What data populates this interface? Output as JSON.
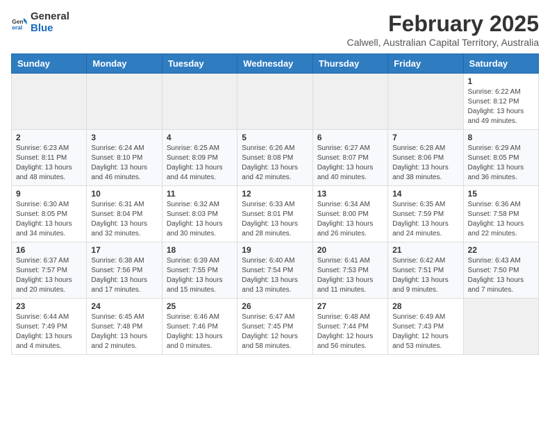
{
  "logo": {
    "line1": "General",
    "line2": "Blue"
  },
  "title": {
    "month_year": "February 2025",
    "location": "Calwell, Australian Capital Territory, Australia"
  },
  "weekdays": [
    "Sunday",
    "Monday",
    "Tuesday",
    "Wednesday",
    "Thursday",
    "Friday",
    "Saturday"
  ],
  "weeks": [
    [
      {
        "day": "",
        "info": ""
      },
      {
        "day": "",
        "info": ""
      },
      {
        "day": "",
        "info": ""
      },
      {
        "day": "",
        "info": ""
      },
      {
        "day": "",
        "info": ""
      },
      {
        "day": "",
        "info": ""
      },
      {
        "day": "1",
        "info": "Sunrise: 6:22 AM\nSunset: 8:12 PM\nDaylight: 13 hours\nand 49 minutes."
      }
    ],
    [
      {
        "day": "2",
        "info": "Sunrise: 6:23 AM\nSunset: 8:11 PM\nDaylight: 13 hours\nand 48 minutes."
      },
      {
        "day": "3",
        "info": "Sunrise: 6:24 AM\nSunset: 8:10 PM\nDaylight: 13 hours\nand 46 minutes."
      },
      {
        "day": "4",
        "info": "Sunrise: 6:25 AM\nSunset: 8:09 PM\nDaylight: 13 hours\nand 44 minutes."
      },
      {
        "day": "5",
        "info": "Sunrise: 6:26 AM\nSunset: 8:08 PM\nDaylight: 13 hours\nand 42 minutes."
      },
      {
        "day": "6",
        "info": "Sunrise: 6:27 AM\nSunset: 8:07 PM\nDaylight: 13 hours\nand 40 minutes."
      },
      {
        "day": "7",
        "info": "Sunrise: 6:28 AM\nSunset: 8:06 PM\nDaylight: 13 hours\nand 38 minutes."
      },
      {
        "day": "8",
        "info": "Sunrise: 6:29 AM\nSunset: 8:05 PM\nDaylight: 13 hours\nand 36 minutes."
      }
    ],
    [
      {
        "day": "9",
        "info": "Sunrise: 6:30 AM\nSunset: 8:05 PM\nDaylight: 13 hours\nand 34 minutes."
      },
      {
        "day": "10",
        "info": "Sunrise: 6:31 AM\nSunset: 8:04 PM\nDaylight: 13 hours\nand 32 minutes."
      },
      {
        "day": "11",
        "info": "Sunrise: 6:32 AM\nSunset: 8:03 PM\nDaylight: 13 hours\nand 30 minutes."
      },
      {
        "day": "12",
        "info": "Sunrise: 6:33 AM\nSunset: 8:01 PM\nDaylight: 13 hours\nand 28 minutes."
      },
      {
        "day": "13",
        "info": "Sunrise: 6:34 AM\nSunset: 8:00 PM\nDaylight: 13 hours\nand 26 minutes."
      },
      {
        "day": "14",
        "info": "Sunrise: 6:35 AM\nSunset: 7:59 PM\nDaylight: 13 hours\nand 24 minutes."
      },
      {
        "day": "15",
        "info": "Sunrise: 6:36 AM\nSunset: 7:58 PM\nDaylight: 13 hours\nand 22 minutes."
      }
    ],
    [
      {
        "day": "16",
        "info": "Sunrise: 6:37 AM\nSunset: 7:57 PM\nDaylight: 13 hours\nand 20 minutes."
      },
      {
        "day": "17",
        "info": "Sunrise: 6:38 AM\nSunset: 7:56 PM\nDaylight: 13 hours\nand 17 minutes."
      },
      {
        "day": "18",
        "info": "Sunrise: 6:39 AM\nSunset: 7:55 PM\nDaylight: 13 hours\nand 15 minutes."
      },
      {
        "day": "19",
        "info": "Sunrise: 6:40 AM\nSunset: 7:54 PM\nDaylight: 13 hours\nand 13 minutes."
      },
      {
        "day": "20",
        "info": "Sunrise: 6:41 AM\nSunset: 7:53 PM\nDaylight: 13 hours\nand 11 minutes."
      },
      {
        "day": "21",
        "info": "Sunrise: 6:42 AM\nSunset: 7:51 PM\nDaylight: 13 hours\nand 9 minutes."
      },
      {
        "day": "22",
        "info": "Sunrise: 6:43 AM\nSunset: 7:50 PM\nDaylight: 13 hours\nand 7 minutes."
      }
    ],
    [
      {
        "day": "23",
        "info": "Sunrise: 6:44 AM\nSunset: 7:49 PM\nDaylight: 13 hours\nand 4 minutes."
      },
      {
        "day": "24",
        "info": "Sunrise: 6:45 AM\nSunset: 7:48 PM\nDaylight: 13 hours\nand 2 minutes."
      },
      {
        "day": "25",
        "info": "Sunrise: 6:46 AM\nSunset: 7:46 PM\nDaylight: 13 hours\nand 0 minutes."
      },
      {
        "day": "26",
        "info": "Sunrise: 6:47 AM\nSunset: 7:45 PM\nDaylight: 12 hours\nand 58 minutes."
      },
      {
        "day": "27",
        "info": "Sunrise: 6:48 AM\nSunset: 7:44 PM\nDaylight: 12 hours\nand 56 minutes."
      },
      {
        "day": "28",
        "info": "Sunrise: 6:49 AM\nSunset: 7:43 PM\nDaylight: 12 hours\nand 53 minutes."
      },
      {
        "day": "",
        "info": ""
      }
    ]
  ]
}
